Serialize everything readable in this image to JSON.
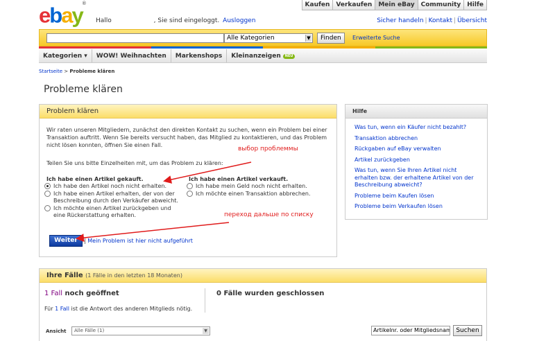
{
  "header": {
    "greeting_prefix": "Hallo",
    "greeting_suffix": ", Sie sind eingeloggt.",
    "logout": "Ausloggen",
    "top_nav": [
      "Kaufen",
      "Verkaufen",
      "Mein eBay",
      "Community",
      "Hilfe"
    ],
    "active_tab": "Mein eBay",
    "util_links": [
      "Sicher handeln",
      "Kontakt",
      "Übersicht"
    ]
  },
  "search": {
    "input_value": "",
    "category": "Alle Kategorien",
    "button": "Finden",
    "advanced": "Erweiterte Suche"
  },
  "stripe_colors": [
    "#e53238",
    "#0064d2",
    "#f5af02",
    "#86b817"
  ],
  "categories": {
    "items": [
      "Kategorien ▾",
      "WOW! Weihnachten",
      "Markenshops",
      "Kleinanzeigen"
    ],
    "new_badge": "NEU"
  },
  "breadcrumb": {
    "home": "Startseite",
    "separator": ">",
    "current": "Probleme klären"
  },
  "page_title": "Probleme klären",
  "problem_box": {
    "title": "Problem klären",
    "intro": "Wir raten unseren Mitgliedern, zunächst den direkten Kontakt zu suchen, wenn ein Problem bei einer Transaktion auftritt. Wenn Sie bereits versucht haben, das Mitglied zu kontaktieren, und das Problem nicht lösen konnten, öffnen Sie einen Fall.",
    "instruction": "Teilen Sie uns bitte Einzelheiten mit, um das Problem zu klären:",
    "bought_title": "Ich habe einen Artikel gekauft.",
    "bought_options": [
      "Ich habe den Artikel noch nicht erhalten.",
      "Ich habe einen Artikel erhalten, der von der Beschreibung durch den Verkäufer abweicht.",
      "Ich möchte einen Artikel zurückgeben und eine Rückerstattung erhalten."
    ],
    "sold_title": "Ich habe einen Artikel verkauft.",
    "sold_options": [
      "Ich habe mein Geld noch nicht erhalten.",
      "Ich möchte einen Transaktion abbrechen."
    ],
    "continue_button": "Weiter",
    "separator": "|",
    "not_listed": "Mein Problem ist hier nicht aufgeführt"
  },
  "annotations": {
    "choose_problem": "выбор проблеммы",
    "go_further": "переход дальше по списку",
    "color": "#e01b1b"
  },
  "help_box": {
    "title": "Hilfe",
    "links": [
      "Was tun, wenn ein Käufer nicht bezahlt?",
      "Transaktion abbrechen",
      "Rückgaben auf eBay verwalten",
      "Artikel zurückgeben",
      "Was tun, wenn Sie Ihren Artikel nicht erhalten bzw. der erhaltene Artikel von der Beschreibung abweicht?",
      "Probleme beim Kaufen lösen",
      "Probleme beim Verkaufen lösen"
    ]
  },
  "cases_box": {
    "title": "Ihre Fälle",
    "subtitle": "(1 Fälle in den letzten 18 Monaten)",
    "open_count": "1 Fall",
    "open_label": "noch geöffnet",
    "open_note_prefix": "Für",
    "open_note_link": "1 Fall",
    "open_note_suffix": "ist die Antwort des anderen Mitglieds nötig.",
    "closed": "0 Fälle wurden geschlossen",
    "view_label": "Ansicht",
    "view_value": "Alle Fälle (1)",
    "search_placeholder": "Artikelnr. oder Mitgliedsname",
    "search_button": "Suchen"
  }
}
